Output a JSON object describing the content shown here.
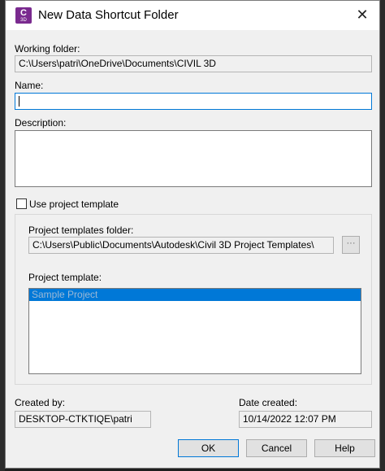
{
  "window": {
    "title": "New Data Shortcut Folder",
    "icon_letter": "C",
    "icon_sub": "3D",
    "close_glyph": "✕"
  },
  "working_folder": {
    "label": "Working folder:",
    "value": "C:\\Users\\patri\\OneDrive\\Documents\\CIVIL 3D"
  },
  "name": {
    "label": "Name:",
    "value": ""
  },
  "description": {
    "label": "Description:",
    "value": ""
  },
  "use_project_template": {
    "label": "Use project template",
    "checked": false
  },
  "project_templates_folder": {
    "label": "Project templates folder:",
    "value": "C:\\Users\\Public\\Documents\\Autodesk\\Civil 3D Project Templates\\",
    "browse_glyph": "···"
  },
  "project_template": {
    "label": "Project template:",
    "items": [
      "Sample Project"
    ]
  },
  "created_by": {
    "label": "Created by:",
    "value": "DESKTOP-CTKTIQE\\patri"
  },
  "date_created": {
    "label": "Date created:",
    "value": "10/14/2022 12:07 PM"
  },
  "buttons": {
    "ok": "OK",
    "cancel": "Cancel",
    "help": "Help"
  }
}
